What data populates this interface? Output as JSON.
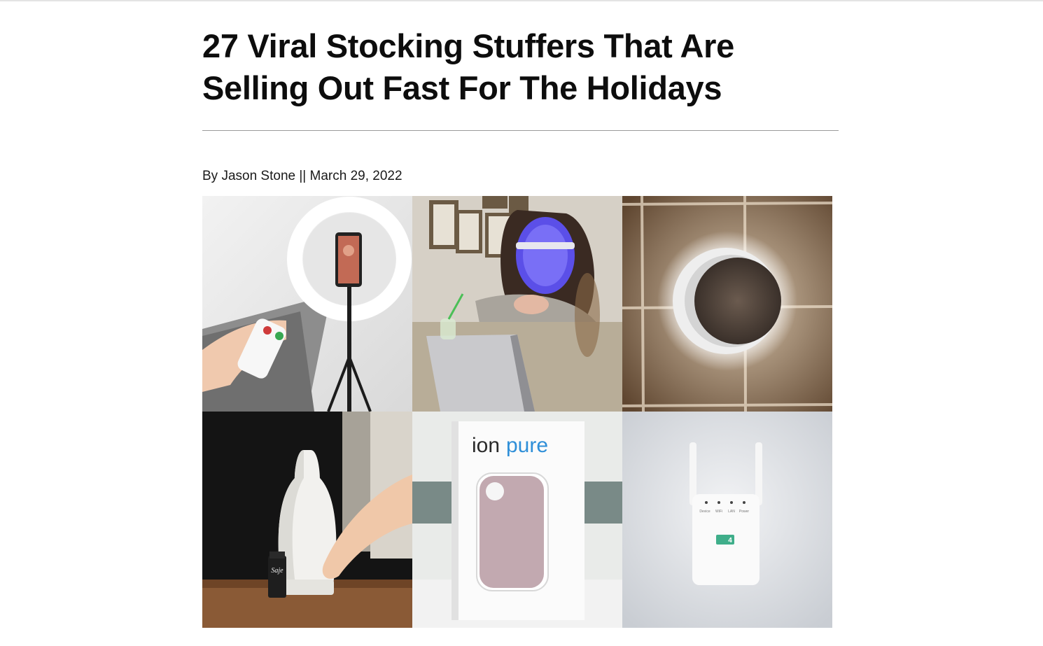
{
  "article": {
    "title_line1": "27 Viral Stocking Stuffers That Are",
    "title_line2": "Selling Out Fast For The Holidays",
    "byline": "By Jason Stone || March 29, 2022"
  },
  "images": [
    {
      "name": "ring-light-tile",
      "subject": "selfie ring light with phone holder and remote"
    },
    {
      "name": "led-mask-tile",
      "subject": "woman wearing blue LED face mask at laptop"
    },
    {
      "name": "speaker-tile",
      "subject": "round plug-in speaker with glowing halo on tiled wall"
    },
    {
      "name": "diffuser-tile",
      "subject": "white ceramic aroma diffuser with essential oil bottle",
      "bottle_label": "Saje"
    },
    {
      "name": "ionpure-tile",
      "subject": "ionpure air purifier box",
      "brand_prefix": "ion",
      "brand_suffix": "pure"
    },
    {
      "name": "wifi-extender-tile",
      "subject": "white wifi extender with two antennas",
      "led_labels": [
        "Device",
        "WiFi",
        "LAN",
        "Power"
      ],
      "badge": "4"
    }
  ],
  "colors": {
    "title": "#0d0d0d",
    "divider": "#9a9a9a",
    "ionpure_blue": "#2f8fd8",
    "badge_green": "#3fae8a"
  }
}
